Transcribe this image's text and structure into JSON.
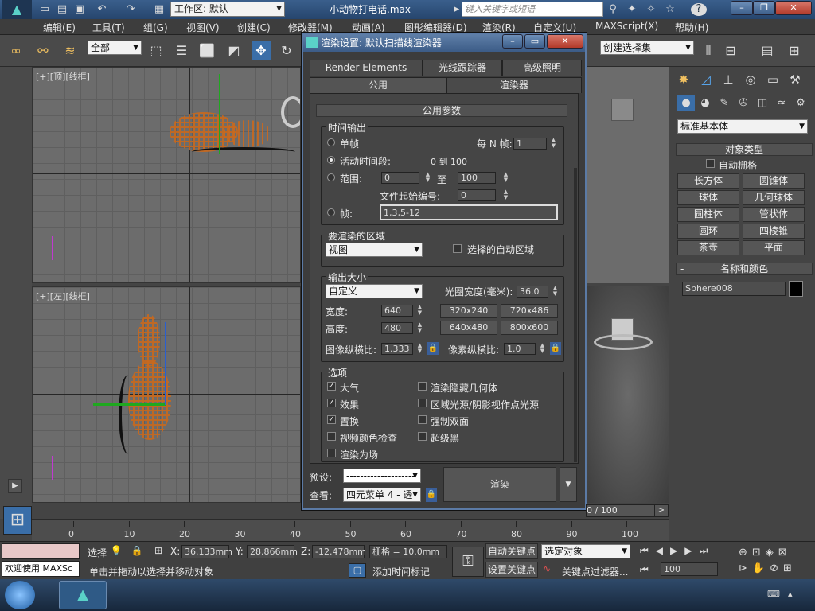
{
  "window": {
    "title": "小动物打电话.max",
    "workspace": "工作区: 默认",
    "search_placeholder": "键入关键字或短语"
  },
  "menu": [
    "编辑(E)",
    "工具(T)",
    "组(G)",
    "视图(V)",
    "创建(C)",
    "修改器(M)",
    "动画(A)",
    "图形编辑器(D)",
    "渲染(R)",
    "自定义(U)",
    "MAXScript(X)",
    "帮助(H)"
  ],
  "toolbar": {
    "selection_filter": "全部",
    "named_selection": "创建选择集"
  },
  "viewports": {
    "top_label": "[+][顶][线框]",
    "left_label": "[+][左][线框]"
  },
  "command_panel": {
    "category": "标准基本体",
    "object_type_title": "对象类型",
    "auto_grid": "自动栅格",
    "objects": [
      "长方体",
      "圆锥体",
      "球体",
      "几何球体",
      "圆柱体",
      "管状体",
      "圆环",
      "四棱锥",
      "茶壶",
      "平面"
    ],
    "name_color_title": "名称和颜色",
    "object_name": "Sphere008"
  },
  "dialog": {
    "title": "渲染设置: 默认扫描线渲染器",
    "tabs_row1": [
      "Render Elements",
      "光线跟踪器",
      "高级照明"
    ],
    "tabs_row2": [
      "公用",
      "渲染器"
    ],
    "rollout_title": "公用参数",
    "time_output": {
      "label": "时间输出",
      "single": "单帧",
      "every_n": "每 N 帧:",
      "every_n_value": "1",
      "active": "活动时间段:",
      "active_range": "0 到 100",
      "range": "范围:",
      "range_from": "0",
      "range_to_label": "至",
      "range_to": "100",
      "file_start": "文件起始编号:",
      "file_start_value": "0",
      "frames": "帧:",
      "frames_value": "1,3,5-12"
    },
    "area": {
      "label": "要渲染的区域",
      "value": "视图",
      "auto_region": "选择的自动区域"
    },
    "output_size": {
      "label": "输出大小",
      "preset": "自定义",
      "aperture_label": "光圈宽度(毫米):",
      "aperture": "36.0",
      "width_label": "宽度:",
      "width": "640",
      "height_label": "高度:",
      "height": "480",
      "presets": [
        "320x240",
        "720x486",
        "640x480",
        "800x600"
      ],
      "image_aspect_label": "图像纵横比:",
      "image_aspect": "1.333",
      "pixel_aspect_label": "像素纵横比:",
      "pixel_aspect": "1.0"
    },
    "options": {
      "label": "选项",
      "items_left": [
        {
          "label": "大气",
          "checked": true
        },
        {
          "label": "效果",
          "checked": true
        },
        {
          "label": "置换",
          "checked": true
        },
        {
          "label": "视频颜色检查",
          "checked": false
        },
        {
          "label": "渲染为场",
          "checked": false
        }
      ],
      "items_right": [
        {
          "label": "渲染隐藏几何体",
          "checked": false
        },
        {
          "label": "区域光源/阴影视作点光源",
          "checked": false
        },
        {
          "label": "强制双面",
          "checked": false
        },
        {
          "label": "超级黑",
          "checked": false
        }
      ]
    },
    "preset_label": "预设:",
    "preset_value": "--------------------",
    "view_label": "查看:",
    "view_value": "四元菜单 4 - 透",
    "render_button": "渲染"
  },
  "timeline": {
    "frame_display": "0 / 100",
    "ticks": [
      "0",
      "10",
      "20",
      "30",
      "40",
      "50",
      "60",
      "70",
      "80",
      "90",
      "100"
    ]
  },
  "status": {
    "script_text": "欢迎使用 MAXSc",
    "sel_label": "选择",
    "x_label": "X:",
    "x": "36.133mm",
    "y_label": "Y:",
    "y": "28.866mm",
    "z_label": "Z:",
    "z": "-12.478mm",
    "grid": "栅格 = 10.0mm",
    "prompt": "单击并拖动以选择并移动对象",
    "add_time_tag": "添加时间标记",
    "auto_key": "自动关键点",
    "set_key": "设置关键点",
    "key_mode": "选定对象",
    "key_filter": "关键点过滤器...",
    "current_frame": "100"
  }
}
